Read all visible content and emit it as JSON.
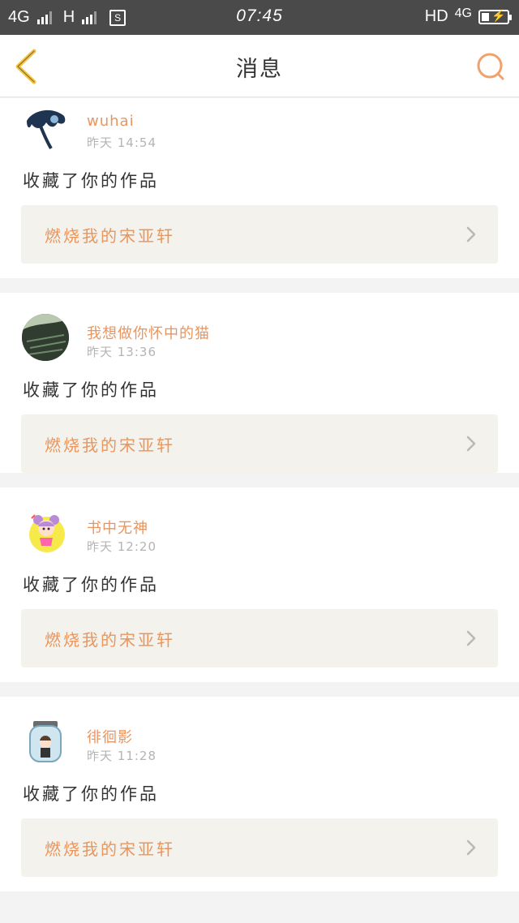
{
  "status_bar": {
    "network_left": "4G",
    "network_mid": "H",
    "sim_icon_label": "S",
    "time": "07:45",
    "hd": "HD",
    "network_right": "4G"
  },
  "header": {
    "title": "消息",
    "back_icon": "chevron-left-icon",
    "search_icon": "search-icon"
  },
  "colors": {
    "accent": "#e9955e",
    "back_arrow": "#f5c33b",
    "status_bar_bg": "#4a4a4a"
  },
  "messages": [
    {
      "user": "wuhai",
      "time": "昨天  14:54",
      "action": "收藏了你的作品",
      "work_title": "燃烧我的宋亚轩"
    },
    {
      "user": "我想做你怀中的猫",
      "time": "昨天  13:36",
      "action": "收藏了你的作品",
      "work_title": "燃烧我的宋亚轩"
    },
    {
      "user": "书中无神",
      "time": "昨天  12:20",
      "action": "收藏了你的作品",
      "work_title": "燃烧我的宋亚轩"
    },
    {
      "user": "徘徊影",
      "time": "昨天  11:28",
      "action": "收藏了你的作品",
      "work_title": "燃烧我的宋亚轩"
    }
  ]
}
